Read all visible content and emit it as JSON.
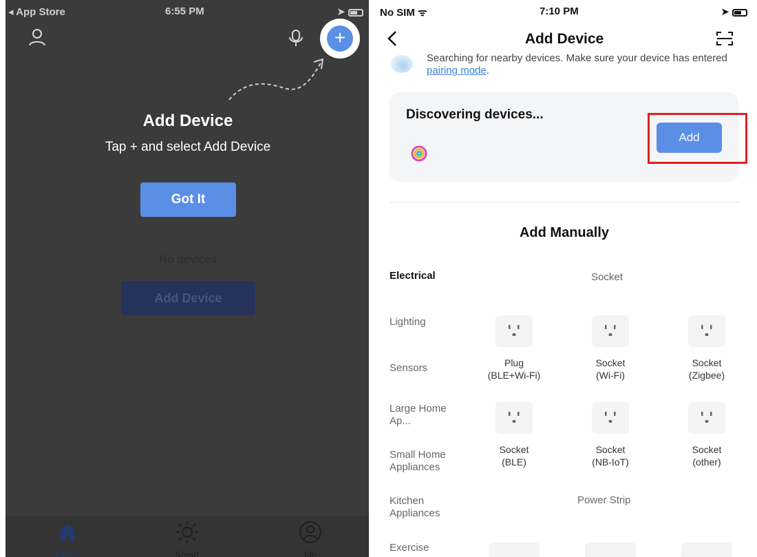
{
  "left": {
    "status_bar": {
      "carrier": "◂ App Store",
      "time": "6:55 PM"
    },
    "title": "Add Device",
    "subtitle": "Tap + and select Add Device",
    "got_it_label": "Got It",
    "no_devices": "No devices",
    "add_device_label": "Add Device",
    "tabs": [
      {
        "label": "Home",
        "icon": "home-icon"
      },
      {
        "label": "Smart",
        "icon": "sun-icon"
      },
      {
        "label": "Me",
        "icon": "profile-icon"
      }
    ],
    "colors": {
      "overlay": "#3b3b3b",
      "accent": "#5b8fe6"
    }
  },
  "right": {
    "status_bar": {
      "carrier": "No SIM",
      "time": "7:10 PM"
    },
    "title": "Add Device",
    "searching": {
      "text_before": "Searching for nearby devices. Make sure your device has entered ",
      "link": "pairing mode",
      "text_after": "."
    },
    "discover": {
      "title": "Discovering devices...",
      "add_label": "Add"
    },
    "add_manually": "Add Manually",
    "categories": [
      "Electrical",
      "Lighting",
      "Sensors",
      "Large Home Ap...",
      "Small Home Appliances",
      "Kitchen Appliances",
      "Exercise"
    ],
    "sections": {
      "socket": "Socket",
      "power_strip": "Power Strip"
    },
    "devices": [
      {
        "line1": "Plug",
        "line2": "(BLE+Wi-Fi)"
      },
      {
        "line1": "Socket",
        "line2": "(Wi-Fi)"
      },
      {
        "line1": "Socket",
        "line2": "(Zigbee)"
      },
      {
        "line1": "Socket",
        "line2": "(BLE)"
      },
      {
        "line1": "Socket",
        "line2": "(NB-IoT)"
      },
      {
        "line1": "Socket",
        "line2": "(other)"
      }
    ],
    "colors": {
      "accent": "#5b8fe6",
      "highlight": "#e02020",
      "link": "#3b82d6"
    }
  }
}
